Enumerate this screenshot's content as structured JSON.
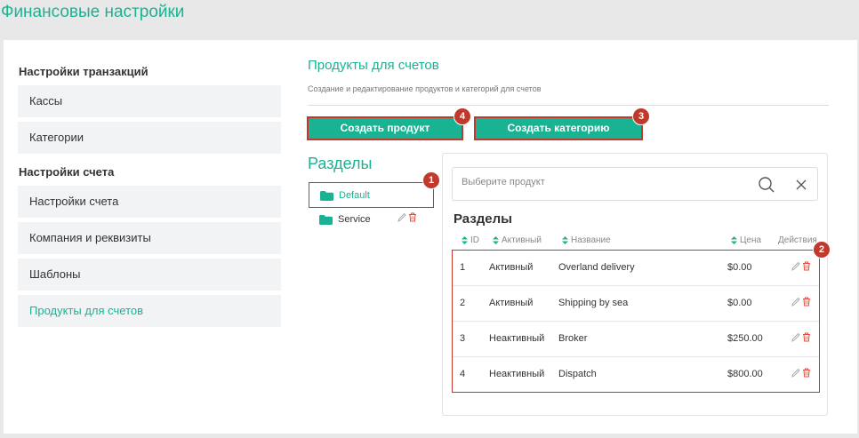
{
  "page": {
    "title": "Финансовые настройки"
  },
  "sidebar": {
    "groups": [
      {
        "heading": "Настройки транзакций",
        "items": [
          "Кассы",
          "Категории"
        ]
      },
      {
        "heading": "Настройки счета",
        "items": [
          "Настройки счета",
          "Компания и реквизиты",
          "Шаблоны",
          "Продукты для счетов"
        ]
      }
    ],
    "active_item": "Продукты для счетов"
  },
  "section": {
    "title": "Продукты для счетов",
    "description": "Создание и редактирование продуктов и категорий для счетов"
  },
  "buttons": {
    "create_product": "Создать продукт",
    "create_category": "Создать категорию"
  },
  "badges": {
    "sections_list": "1",
    "table": "2",
    "create_category": "3",
    "create_product": "4"
  },
  "sections": {
    "title": "Разделы",
    "items": [
      {
        "name": "Default",
        "active": true
      },
      {
        "name": "Service",
        "active": false
      }
    ]
  },
  "products": {
    "search_placeholder": "Выберите продукт",
    "table_title": "Разделы",
    "columns": [
      "ID",
      "Активный",
      "Название",
      "Цена",
      "Действия"
    ],
    "rows": [
      {
        "id": "1",
        "status": "Активный",
        "name": "Overland delivery",
        "price": "$0.00"
      },
      {
        "id": "2",
        "status": "Активный",
        "name": "Shipping by sea",
        "price": "$0.00"
      },
      {
        "id": "3",
        "status": "Неактивный",
        "name": "Broker",
        "price": "$250.00"
      },
      {
        "id": "4",
        "status": "Неактивный",
        "name": "Dispatch",
        "price": "$800.00"
      }
    ]
  },
  "colors": {
    "accent": "#19b394",
    "annotation": "#c0392b",
    "delete": "#e74c3c",
    "edit": "#aaaaaa"
  }
}
